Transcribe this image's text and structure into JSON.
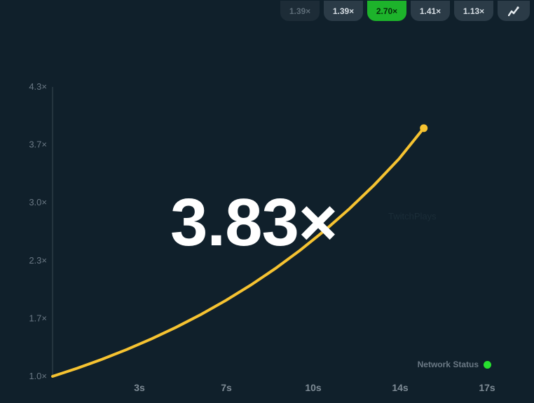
{
  "history": {
    "items": [
      {
        "label": "1.39×",
        "state": "faded"
      },
      {
        "label": "1.39×",
        "state": "normal"
      },
      {
        "label": "2.70×",
        "state": "win"
      },
      {
        "label": "1.41×",
        "state": "normal"
      },
      {
        "label": "1.13×",
        "state": "normal"
      }
    ],
    "chart_button_icon": "trend-chart-icon"
  },
  "multiplier": "3.83×",
  "watermark": "TwitchPlays",
  "network_status": {
    "label": "Network Status",
    "color": "#27e02f"
  },
  "colors": {
    "curve": "#f6c331",
    "win_badge": "#1db32b",
    "background": "#10202b"
  },
  "chart_data": {
    "type": "line",
    "title": "",
    "xlabel": "",
    "ylabel": "",
    "y_tick_labels": [
      "1.0×",
      "1.7×",
      "2.3×",
      "3.0×",
      "3.7×",
      "4.3×"
    ],
    "x_tick_labels": [
      "3s",
      "7s",
      "10s",
      "14s",
      "17s"
    ],
    "xlim": [
      0,
      17.5
    ],
    "ylim": [
      1.0,
      4.3
    ],
    "series": [
      {
        "x": [
          0,
          1,
          2,
          3,
          4,
          5,
          6,
          7,
          8,
          9,
          10,
          11,
          12,
          13,
          14,
          15
        ],
        "y": [
          1.0,
          1.093,
          1.195,
          1.306,
          1.428,
          1.561,
          1.706,
          1.865,
          2.039,
          2.229,
          2.437,
          2.664,
          2.912,
          3.183,
          3.48,
          3.83
        ]
      }
    ],
    "end_point": {
      "x": 15,
      "y": 3.83
    }
  }
}
